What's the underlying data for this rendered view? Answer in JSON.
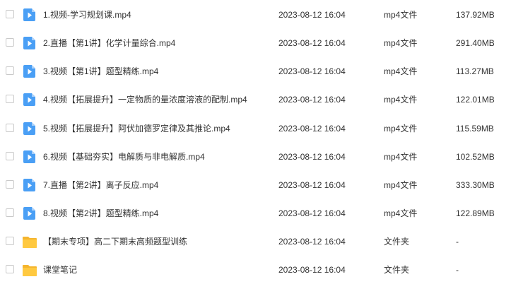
{
  "files": [
    {
      "name": "1.视频-学习规划课.mp4",
      "date": "2023-08-12 16:04",
      "type": "mp4文件",
      "size": "137.92MB",
      "icon": "video-file-icon"
    },
    {
      "name": "2.直播【第1讲】化学计量综合.mp4",
      "date": "2023-08-12 16:04",
      "type": "mp4文件",
      "size": "291.40MB",
      "icon": "video-file-icon"
    },
    {
      "name": "3.视频【第1讲】题型精练.mp4",
      "date": "2023-08-12 16:04",
      "type": "mp4文件",
      "size": "113.27MB",
      "icon": "video-file-icon"
    },
    {
      "name": "4.视频【拓展提升】一定物质的量浓度溶液的配制.mp4",
      "date": "2023-08-12 16:04",
      "type": "mp4文件",
      "size": "122.01MB",
      "icon": "video-file-icon"
    },
    {
      "name": "5.视频【拓展提升】阿伏加德罗定律及其推论.mp4",
      "date": "2023-08-12 16:04",
      "type": "mp4文件",
      "size": "115.59MB",
      "icon": "video-file-icon"
    },
    {
      "name": "6.视频【基础夯实】电解质与非电解质.mp4",
      "date": "2023-08-12 16:04",
      "type": "mp4文件",
      "size": "102.52MB",
      "icon": "video-file-icon"
    },
    {
      "name": "7.直播【第2讲】离子反应.mp4",
      "date": "2023-08-12 16:04",
      "type": "mp4文件",
      "size": "333.30MB",
      "icon": "video-file-icon"
    },
    {
      "name": "8.视频【第2讲】题型精练.mp4",
      "date": "2023-08-12 16:04",
      "type": "mp4文件",
      "size": "122.89MB",
      "icon": "video-file-icon"
    },
    {
      "name": "【期末专项】高二下期末高频题型训练",
      "date": "2023-08-12 16:04",
      "type": "文件夹",
      "size": "-",
      "icon": "folder-icon"
    },
    {
      "name": "课堂笔记",
      "date": "2023-08-12 16:04",
      "type": "文件夹",
      "size": "-",
      "icon": "folder-icon"
    }
  ],
  "colors": {
    "video_icon": "#4a9ff5",
    "folder_icon": "#ffc940"
  }
}
